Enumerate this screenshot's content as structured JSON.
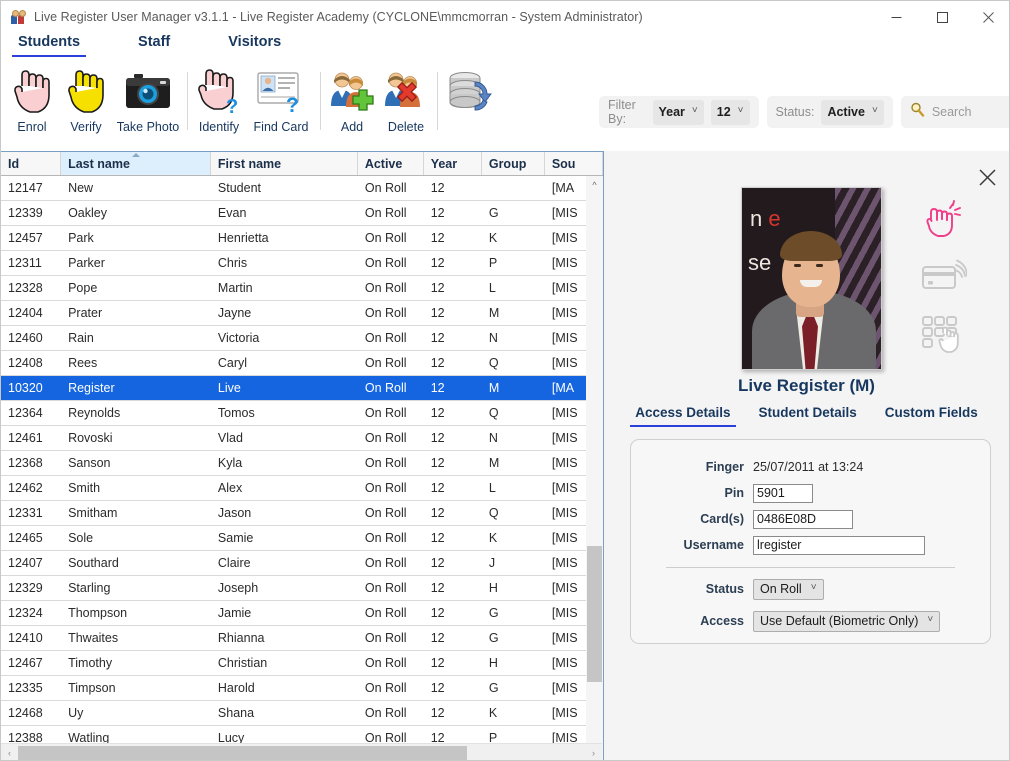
{
  "window": {
    "title": "Live Register User Manager v3.1.1 - Live Register Academy (CYCLONE\\mmcmorran - System Administrator)",
    "app_icon": "people-icon",
    "minimize_label": "Minimize",
    "maximize_label": "Maximize",
    "close_label": "Close"
  },
  "main_tabs": [
    {
      "label": "Students",
      "active": true
    },
    {
      "label": "Staff",
      "active": false
    },
    {
      "label": "Visitors",
      "active": false
    }
  ],
  "toolbar": {
    "items": [
      {
        "label": "Enrol",
        "icon": "hand-pink-icon"
      },
      {
        "label": "Verify",
        "icon": "hand-yellow-icon"
      },
      {
        "label": "Take Photo",
        "icon": "camera-icon"
      },
      {
        "separator_after": true
      },
      {
        "label": "Identify",
        "icon": "hand-question-icon"
      },
      {
        "label": "Find Card",
        "icon": "id-card-question-icon"
      },
      {
        "separator_after": true
      },
      {
        "label": "Add",
        "icon": "people-add-icon"
      },
      {
        "label": "Delete",
        "icon": "people-delete-icon"
      },
      {
        "separator_after": true
      },
      {
        "label": "Refresh",
        "icon": "database-refresh-icon"
      }
    ]
  },
  "filters": {
    "filter_by_label": "Filter By:",
    "filter_field_value": "Year",
    "filter_value_value": "12",
    "status_label": "Status:",
    "status_value": "Active",
    "search_placeholder": "Search",
    "search_icon": "magnifier-icon"
  },
  "grid": {
    "columns": [
      {
        "key": "id",
        "label": "Id",
        "sorted": false
      },
      {
        "key": "last",
        "label": "Last name",
        "sorted": true,
        "sort_dir": "asc"
      },
      {
        "key": "first",
        "label": "First name",
        "sorted": false
      },
      {
        "key": "active",
        "label": "Active",
        "sorted": false
      },
      {
        "key": "year",
        "label": "Year",
        "sorted": false
      },
      {
        "key": "group",
        "label": "Group",
        "sorted": false
      },
      {
        "key": "source",
        "label": "Sou",
        "sorted": false
      }
    ],
    "rows": [
      {
        "id": "12147",
        "last": "New",
        "first": "Student",
        "active": "On Roll",
        "year": "12",
        "group": "",
        "source": "[MA",
        "selected": false
      },
      {
        "id": "12339",
        "last": "Oakley",
        "first": "Evan",
        "active": "On Roll",
        "year": "12",
        "group": "G",
        "source": "[MIS",
        "selected": false
      },
      {
        "id": "12457",
        "last": "Park",
        "first": "Henrietta",
        "active": "On Roll",
        "year": "12",
        "group": "K",
        "source": "[MIS",
        "selected": false
      },
      {
        "id": "12311",
        "last": "Parker",
        "first": "Chris",
        "active": "On Roll",
        "year": "12",
        "group": "P",
        "source": "[MIS",
        "selected": false
      },
      {
        "id": "12328",
        "last": "Pope",
        "first": "Martin",
        "active": "On Roll",
        "year": "12",
        "group": "L",
        "source": "[MIS",
        "selected": false
      },
      {
        "id": "12404",
        "last": "Prater",
        "first": "Jayne",
        "active": "On Roll",
        "year": "12",
        "group": "M",
        "source": "[MIS",
        "selected": false
      },
      {
        "id": "12460",
        "last": "Rain",
        "first": "Victoria",
        "active": "On Roll",
        "year": "12",
        "group": "N",
        "source": "[MIS",
        "selected": false
      },
      {
        "id": "12408",
        "last": "Rees",
        "first": "Caryl",
        "active": "On Roll",
        "year": "12",
        "group": "Q",
        "source": "[MIS",
        "selected": false
      },
      {
        "id": "10320",
        "last": "Register",
        "first": "Live",
        "active": "On Roll",
        "year": "12",
        "group": "M",
        "source": "[MA",
        "selected": true
      },
      {
        "id": "12364",
        "last": "Reynolds",
        "first": "Tomos",
        "active": "On Roll",
        "year": "12",
        "group": "Q",
        "source": "[MIS",
        "selected": false
      },
      {
        "id": "12461",
        "last": "Rovoski",
        "first": "Vlad",
        "active": "On Roll",
        "year": "12",
        "group": "N",
        "source": "[MIS",
        "selected": false
      },
      {
        "id": "12368",
        "last": "Sanson",
        "first": "Kyla",
        "active": "On Roll",
        "year": "12",
        "group": "M",
        "source": "[MIS",
        "selected": false
      },
      {
        "id": "12462",
        "last": "Smith",
        "first": "Alex",
        "active": "On Roll",
        "year": "12",
        "group": "L",
        "source": "[MIS",
        "selected": false
      },
      {
        "id": "12331",
        "last": "Smitham",
        "first": "Jason",
        "active": "On Roll",
        "year": "12",
        "group": "Q",
        "source": "[MIS",
        "selected": false
      },
      {
        "id": "12465",
        "last": "Sole",
        "first": "Samie",
        "active": "On Roll",
        "year": "12",
        "group": "K",
        "source": "[MIS",
        "selected": false
      },
      {
        "id": "12407",
        "last": "Southard",
        "first": "Claire",
        "active": "On Roll",
        "year": "12",
        "group": "J",
        "source": "[MIS",
        "selected": false
      },
      {
        "id": "12329",
        "last": "Starling",
        "first": "Joseph",
        "active": "On Roll",
        "year": "12",
        "group": "H",
        "source": "[MIS",
        "selected": false
      },
      {
        "id": "12324",
        "last": "Thompson",
        "first": "Jamie",
        "active": "On Roll",
        "year": "12",
        "group": "G",
        "source": "[MIS",
        "selected": false
      },
      {
        "id": "12410",
        "last": "Thwaites",
        "first": "Rhianna",
        "active": "On Roll",
        "year": "12",
        "group": "G",
        "source": "[MIS",
        "selected": false
      },
      {
        "id": "12467",
        "last": "Timothy",
        "first": "Christian",
        "active": "On Roll",
        "year": "12",
        "group": "H",
        "source": "[MIS",
        "selected": false
      },
      {
        "id": "12335",
        "last": "Timpson",
        "first": "Harold",
        "active": "On Roll",
        "year": "12",
        "group": "G",
        "source": "[MIS",
        "selected": false
      },
      {
        "id": "12468",
        "last": "Uy",
        "first": "Shana",
        "active": "On Roll",
        "year": "12",
        "group": "K",
        "source": "[MIS",
        "selected": false
      },
      {
        "id": "12388",
        "last": "Watling",
        "first": "Lucy",
        "active": "On Roll",
        "year": "12",
        "group": "P",
        "source": "[MIS",
        "selected": false
      }
    ]
  },
  "detail_panel": {
    "close_icon": "close-icon",
    "photo_alt": "student-photo",
    "photo_text_line1": "n e",
    "photo_text_line2": "se",
    "person_name": "Live Register (M)",
    "biometric_icons": [
      {
        "name": "fingerprint-tap-icon",
        "active": true,
        "color": "#ef3d8a"
      },
      {
        "name": "contactless-card-icon",
        "active": false,
        "color": "#c9c9c9"
      },
      {
        "name": "keypad-pin-icon",
        "active": false,
        "color": "#c9c9c9"
      }
    ],
    "tabs": [
      {
        "label": "Access Details",
        "active": true
      },
      {
        "label": "Student Details",
        "active": false
      },
      {
        "label": "Custom Fields",
        "active": false
      }
    ],
    "fields": {
      "finger_label": "Finger",
      "finger_value": "25/07/2011 at 13:24",
      "pin_label": "Pin",
      "pin_value": "5901",
      "cards_label": "Card(s)",
      "cards_value": "0486E08D",
      "username_label": "Username",
      "username_value": "lregister",
      "status_label": "Status",
      "status_value": "On Roll",
      "access_label": "Access",
      "access_value": "Use Default (Biometric Only)"
    }
  },
  "colors": {
    "accent_blue": "#2b3fd9",
    "selection_blue": "#1565e0",
    "header_navy": "#17375e",
    "pink_accent": "#ef3d8a"
  }
}
